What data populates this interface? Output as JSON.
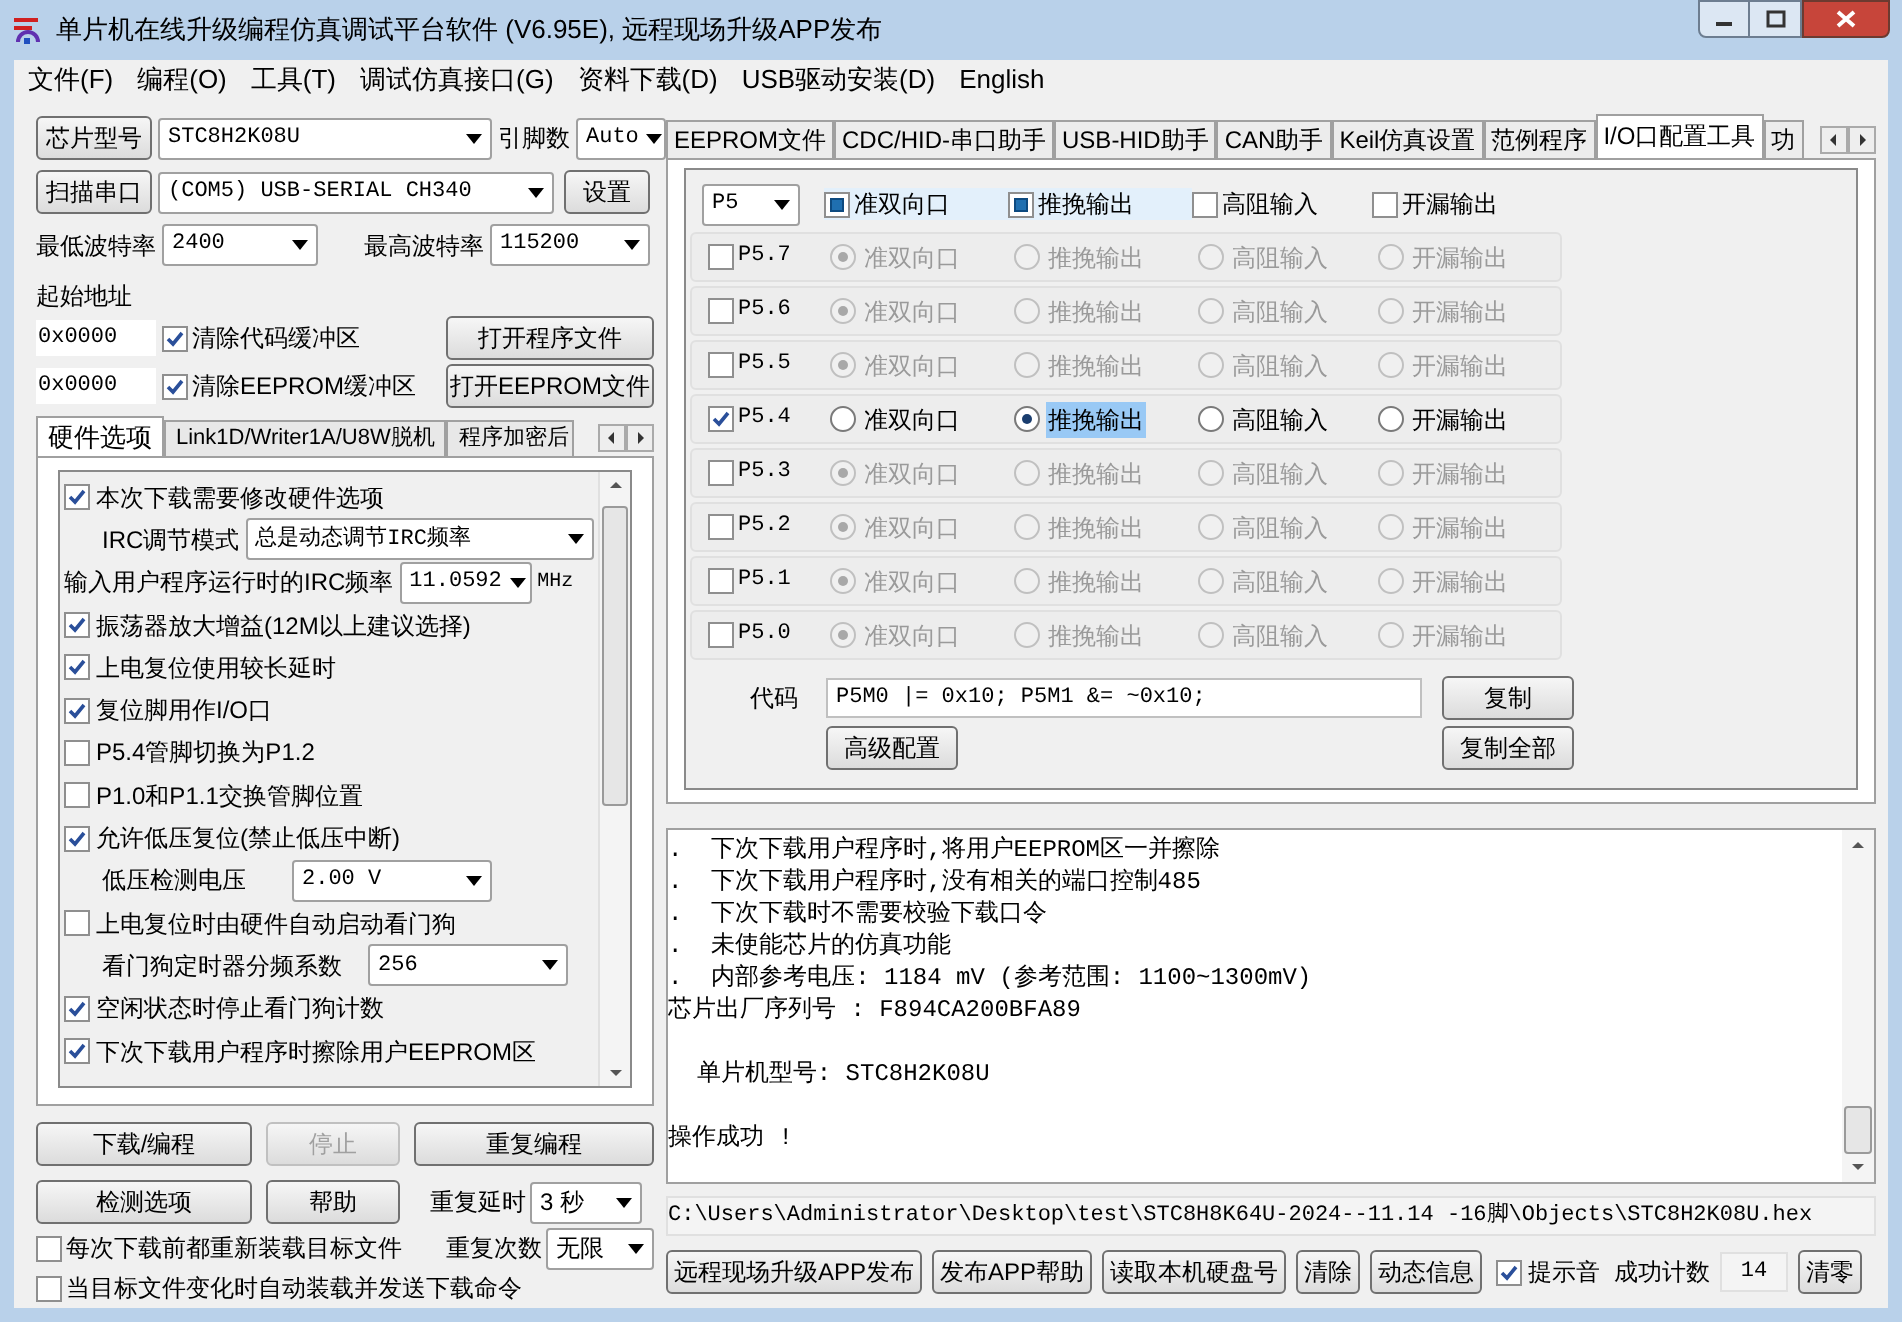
{
  "window": {
    "title": "单片机在线升级编程仿真调试平台软件 (V6.95E), 远程现场升级APP发布"
  },
  "menu": [
    {
      "label": "文件(F)"
    },
    {
      "label": "编程(O)"
    },
    {
      "label": "工具(T)"
    },
    {
      "label": "调试仿真接口(G)"
    },
    {
      "label": "资料下载(D)"
    },
    {
      "label": "USB驱动安装(D)"
    },
    {
      "label": "English"
    }
  ],
  "chip": {
    "button": "芯片型号",
    "value": "STC8H2K08U",
    "pins_label": "引脚数",
    "pins": "Auto"
  },
  "port": {
    "button": "扫描串口",
    "value": "(COM5) USB-SERIAL CH340",
    "settings": "设置"
  },
  "baud": {
    "min_label": "最低波特率",
    "min": "2400",
    "max_label": "最高波特率",
    "max": "115200"
  },
  "start_address_label": "起始地址",
  "buffers": [
    {
      "address": "0x0000",
      "label": "清除代码缓冲区",
      "checked": true,
      "button": "打开程序文件"
    },
    {
      "address": "0x0000",
      "label": "清除EEPROM缓冲区",
      "checked": true,
      "button": "打开EEPROM文件"
    }
  ],
  "option_tabs": [
    {
      "label": "硬件选项",
      "selected": true
    },
    {
      "label": "Link1D/Writer1A/U8W脱机",
      "selected": false
    },
    {
      "label": "程序加密后",
      "selected": false
    }
  ],
  "hardware_options": [
    {
      "kind": "checkbox",
      "label": "本次下载需要修改硬件选项",
      "checked": true
    },
    {
      "kind": "select",
      "label": "IRC调节模式",
      "value": "总是动态调节IRC频率"
    },
    {
      "kind": "select_unit",
      "label": "输入用户程序运行时的IRC频率",
      "value": "11.0592",
      "unit": "MHz"
    },
    {
      "kind": "checkbox",
      "label": "振荡器放大增益(12M以上建议选择)",
      "checked": true
    },
    {
      "kind": "checkbox",
      "label": "上电复位使用较长延时",
      "checked": true
    },
    {
      "kind": "checkbox",
      "label": "复位脚用作I/O口",
      "checked": true
    },
    {
      "kind": "checkbox",
      "label": "P5.4管脚切换为P1.2",
      "checked": false
    },
    {
      "kind": "checkbox",
      "label": "P1.0和P1.1交换管脚位置",
      "checked": false
    },
    {
      "kind": "checkbox",
      "label": "允许低压复位(禁止低压中断)",
      "checked": true
    },
    {
      "kind": "select",
      "label": "低压检测电压",
      "value": "2.00 V"
    },
    {
      "kind": "checkbox",
      "label": "上电复位时由硬件自动启动看门狗",
      "checked": false
    },
    {
      "kind": "select",
      "label": "看门狗定时器分频系数",
      "value": "256"
    },
    {
      "kind": "checkbox",
      "label": "空闲状态时停止看门狗计数",
      "checked": true
    },
    {
      "kind": "checkbox",
      "label": "下次下载用户程序时擦除用户EEPROM区",
      "checked": true
    }
  ],
  "actions": [
    {
      "label": "下载/编程",
      "disabled": false
    },
    {
      "label": "停止",
      "disabled": true
    },
    {
      "label": "重复编程",
      "disabled": false
    },
    {
      "label": "检测选项",
      "disabled": false
    },
    {
      "label": "帮助",
      "disabled": false
    }
  ],
  "repeat_delay": {
    "label": "重复延时",
    "value": "3 秒"
  },
  "repeat_count": {
    "label": "重复次数",
    "value": "无限"
  },
  "auto_options": [
    {
      "label": "每次下载前都重新装载目标文件",
      "checked": false
    },
    {
      "label": "当目标文件变化时自动装载并发送下载命令",
      "checked": false
    }
  ],
  "tabs": [
    {
      "label": "EEPROM文件",
      "selected": false
    },
    {
      "label": "CDC/HID-串口助手",
      "selected": false
    },
    {
      "label": "USB-HID助手",
      "selected": false
    },
    {
      "label": "CAN助手",
      "selected": false
    },
    {
      "label": "Keil仿真设置",
      "selected": false
    },
    {
      "label": "范例程序",
      "selected": false
    },
    {
      "label": "I/O口配置工具",
      "selected": true
    },
    {
      "label": "功",
      "selected": false
    }
  ],
  "io": {
    "port": "P5",
    "header_modes": [
      {
        "label": "准双向口",
        "checked": true
      },
      {
        "label": "推挽输出",
        "checked": true
      },
      {
        "label": "高阻输入",
        "checked": false
      },
      {
        "label": "开漏输出",
        "checked": false
      }
    ],
    "pins": [
      {
        "name": "P5.7",
        "checked": false,
        "modes": [
          {
            "label": "准双向口",
            "selected": true
          },
          {
            "label": "推挽输出",
            "selected": false
          },
          {
            "label": "高阻输入",
            "selected": false
          },
          {
            "label": "开漏输出",
            "selected": false
          }
        ]
      },
      {
        "name": "P5.6",
        "checked": false,
        "modes": [
          {
            "label": "准双向口",
            "selected": true
          },
          {
            "label": "推挽输出",
            "selected": false
          },
          {
            "label": "高阻输入",
            "selected": false
          },
          {
            "label": "开漏输出",
            "selected": false
          }
        ]
      },
      {
        "name": "P5.5",
        "checked": false,
        "modes": [
          {
            "label": "准双向口",
            "selected": true
          },
          {
            "label": "推挽输出",
            "selected": false
          },
          {
            "label": "高阻输入",
            "selected": false
          },
          {
            "label": "开漏输出",
            "selected": false
          }
        ]
      },
      {
        "name": "P5.4",
        "checked": true,
        "modes": [
          {
            "label": "准双向口",
            "selected": false
          },
          {
            "label": "推挽输出",
            "selected": true
          },
          {
            "label": "高阻输入",
            "selected": false
          },
          {
            "label": "开漏输出",
            "selected": false
          }
        ]
      },
      {
        "name": "P5.3",
        "checked": false,
        "modes": [
          {
            "label": "准双向口",
            "selected": true
          },
          {
            "label": "推挽输出",
            "selected": false
          },
          {
            "label": "高阻输入",
            "selected": false
          },
          {
            "label": "开漏输出",
            "selected": false
          }
        ]
      },
      {
        "name": "P5.2",
        "checked": false,
        "modes": [
          {
            "label": "准双向口",
            "selected": true
          },
          {
            "label": "推挽输出",
            "selected": false
          },
          {
            "label": "高阻输入",
            "selected": false
          },
          {
            "label": "开漏输出",
            "selected": false
          }
        ]
      },
      {
        "name": "P5.1",
        "checked": false,
        "modes": [
          {
            "label": "准双向口",
            "selected": true
          },
          {
            "label": "推挽输出",
            "selected": false
          },
          {
            "label": "高阻输入",
            "selected": false
          },
          {
            "label": "开漏输出",
            "selected": false
          }
        ]
      },
      {
        "name": "P5.0",
        "checked": false,
        "modes": [
          {
            "label": "准双向口",
            "selected": true
          },
          {
            "label": "推挽输出",
            "selected": false
          },
          {
            "label": "高阻输入",
            "selected": false
          },
          {
            "label": "开漏输出",
            "selected": false
          }
        ]
      }
    ],
    "code_label": "代码",
    "code": "P5M0 |= 0x10; P5M1 &= ~0x10;",
    "copy": "复制",
    "advanced": "高级配置",
    "copy_all": "复制全部"
  },
  "log_paragraphs": [
    {
      "lines": [
        ".  下次下载用户程序时,将用户EEPROM区一并擦除",
        ".  下次下载用户程序时,没有相关的端口控制485",
        ".  下次下载时不需要校验下载口令",
        ".  未使能芯片的仿真功能",
        ".  内部参考电压: 1184 mV (参考范围: 1100~1300mV)",
        "芯片出厂序列号 : F894CA200BFA89"
      ]
    },
    {
      "lines": [
        "  单片机型号: STC8H2K08U"
      ]
    },
    {
      "lines": [
        "操作成功 !"
      ]
    }
  ],
  "file_path": "C:\\Users\\Administrator\\Desktop\\test\\STC8H8K64U-2024--11.14 -16脚\\Objects\\STC8H2K08U.hex",
  "bottom_buttons": [
    {
      "label": "远程现场升级APP发布"
    },
    {
      "label": "发布APP帮助"
    },
    {
      "label": "读取本机硬盘号"
    },
    {
      "label": "清除"
    },
    {
      "label": "动态信息"
    }
  ],
  "beep": {
    "label": "提示音",
    "checked": true
  },
  "success_count": {
    "label": "成功计数",
    "value": "14",
    "reset": "清零"
  }
}
